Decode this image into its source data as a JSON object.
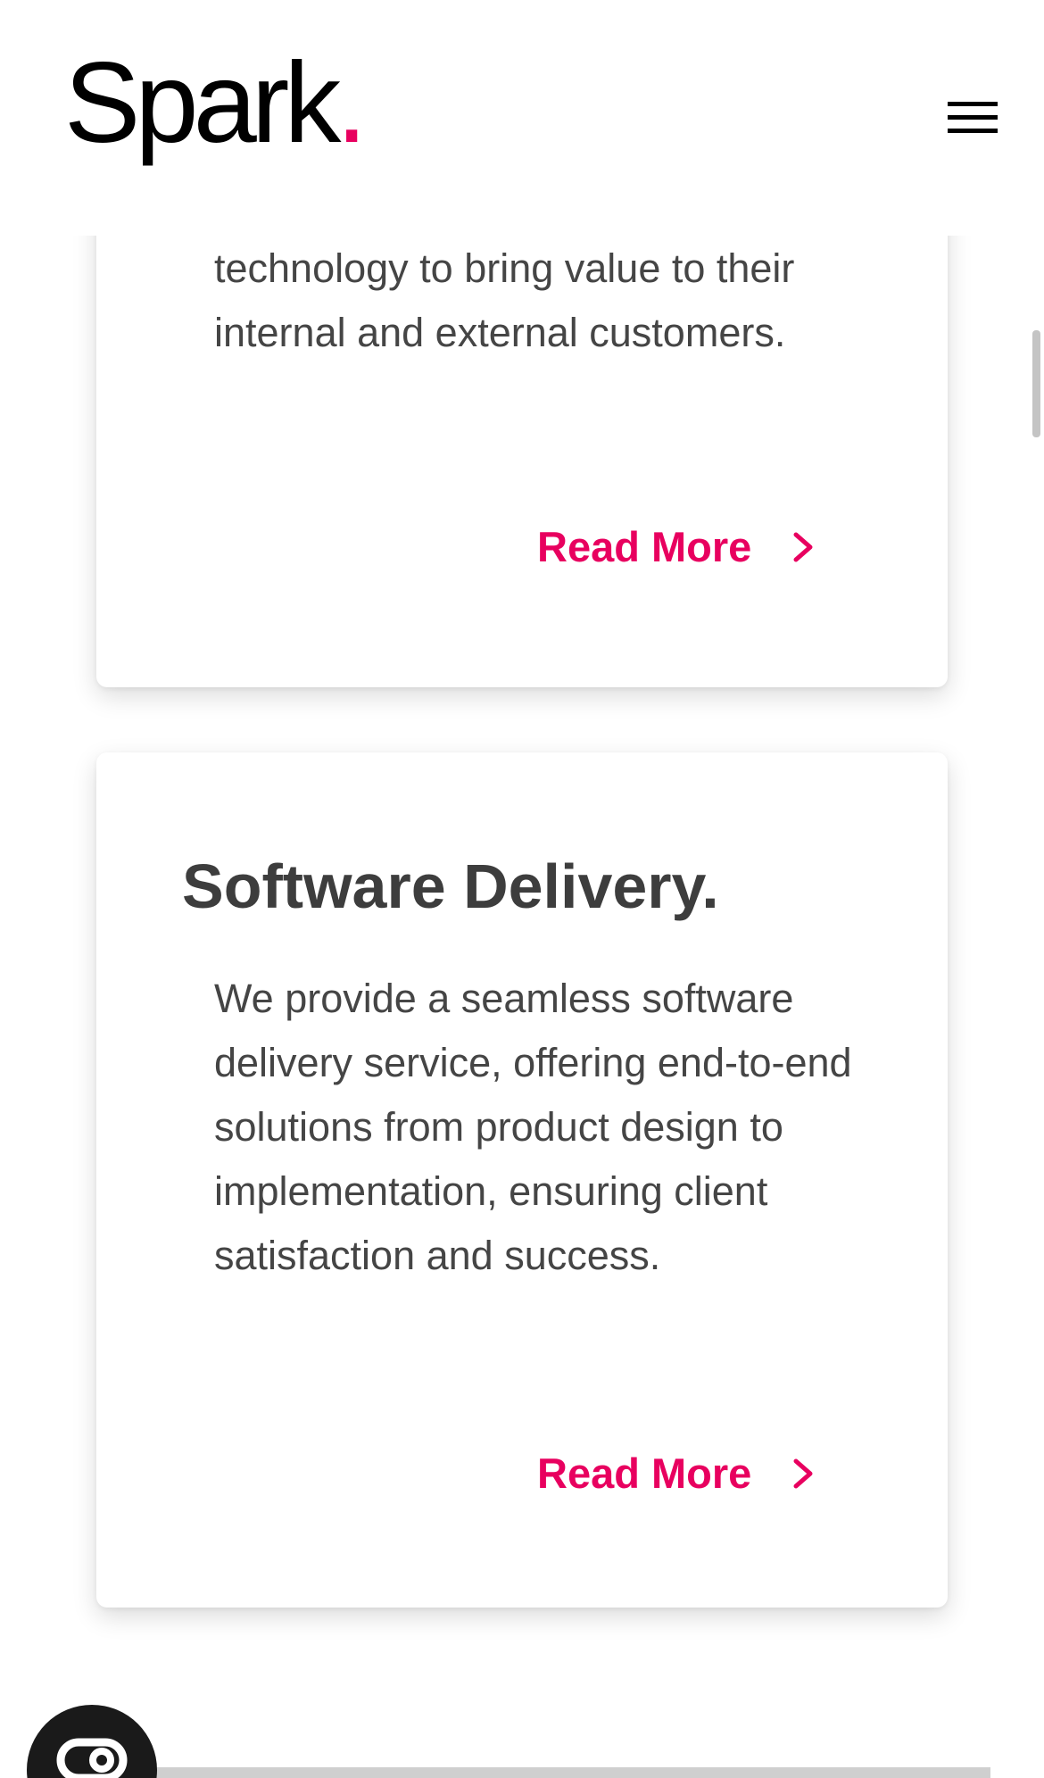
{
  "header": {
    "logo_text": "Spark",
    "logo_dot": ".",
    "menu_icon": "hamburger-menu-icon"
  },
  "colors": {
    "accent": "#e8005f",
    "heading": "#3d3d3d",
    "body_text": "#454545"
  },
  "cards": [
    {
      "body": "technology to bring value to their internal and external customers.",
      "cta_label": "Read More",
      "cta_icon": "chevron-right-icon"
    },
    {
      "title": "Software Delivery.",
      "body": "We provide a seamless software delivery service, offering end-to-end solutions from product design to implementation, ensuring client satisfaction and success.",
      "cta_label": "Read More",
      "cta_icon": "chevron-right-icon"
    }
  ],
  "floating_button": {
    "icon": "chat-icon"
  }
}
